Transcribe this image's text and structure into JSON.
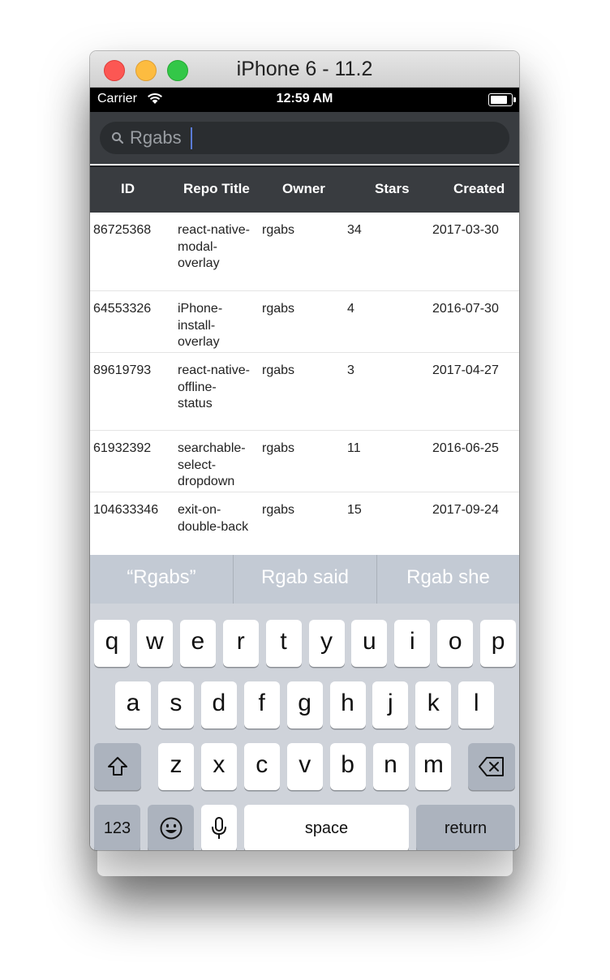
{
  "window": {
    "title": "iPhone 6 - 11.2"
  },
  "status_bar": {
    "carrier": "Carrier",
    "time": "12:59 AM",
    "wifi_icon": "wifi-icon",
    "battery_icon": "battery-icon"
  },
  "search": {
    "value": "Rgabs",
    "icon": "search-icon"
  },
  "table": {
    "columns": [
      "ID",
      "Repo Title",
      "Owner",
      "Stars",
      "Created"
    ],
    "rows": [
      {
        "id": "86725368",
        "title": "react-native-\nmodal-\noverlay",
        "owner": "rgabs",
        "stars": "34",
        "created": "2017-03-30"
      },
      {
        "id": "64553326",
        "title": "iPhone-\ninstall-\noverlay",
        "owner": "rgabs",
        "stars": "4",
        "created": "2016-07-30"
      },
      {
        "id": "89619793",
        "title": "react-native-\noffline-\nstatus",
        "owner": "rgabs",
        "stars": "3",
        "created": "2017-04-27"
      },
      {
        "id": "61932392",
        "title": "searchable-\nselect-\ndropdown",
        "owner": "rgabs",
        "stars": "11",
        "created": "2016-06-25"
      },
      {
        "id": "104633346",
        "title": "exit-on-\ndouble-back",
        "owner": "rgabs",
        "stars": "15",
        "created": "2017-09-24"
      }
    ]
  },
  "suggestions": [
    "“Rgabs”",
    "Rgab said",
    "Rgab she"
  ],
  "keyboard": {
    "row1": [
      "q",
      "w",
      "e",
      "r",
      "t",
      "y",
      "u",
      "i",
      "o",
      "p"
    ],
    "row2": [
      "a",
      "s",
      "d",
      "f",
      "g",
      "h",
      "j",
      "k",
      "l"
    ],
    "row3": [
      "z",
      "x",
      "c",
      "v",
      "b",
      "n",
      "m"
    ],
    "shift_icon": "shift-icon",
    "delete_icon": "delete-icon",
    "numbers_label": "123",
    "emoji_icon": "emoji-icon",
    "mic_icon": "microphone-icon",
    "space_label": "space",
    "return_label": "return"
  }
}
